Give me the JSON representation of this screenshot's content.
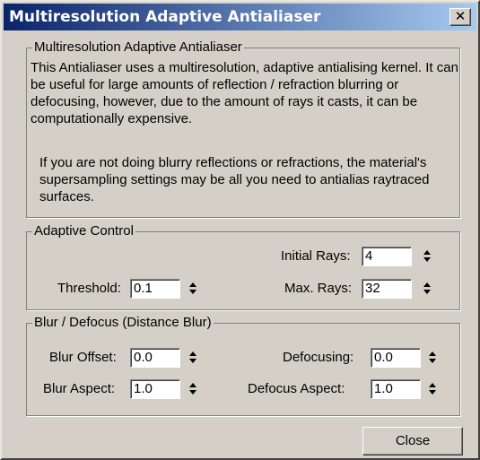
{
  "window": {
    "title": "Multiresolution Adaptive Antialiaser",
    "close_icon": "close-x-icon"
  },
  "description": {
    "legend": "Multiresolution Adaptive Antialiaser",
    "paragraph1": "This Antialiaser uses a multiresolution, adaptive antialising kernel.  It can be useful for large amounts of reflection / refraction blurring or defocusing, however, due to the amount of rays it casts, it can be computationally expensive.",
    "paragraph2": "If you are not doing blurry reflections or refractions, the material's supersampling settings may be all you need to antialias raytraced surfaces."
  },
  "adaptive_control": {
    "legend": "Adaptive Control",
    "initial_rays_label": "Initial Rays:",
    "initial_rays_value": "4",
    "threshold_label": "Threshold:",
    "threshold_value": "0.1",
    "max_rays_label": "Max. Rays:",
    "max_rays_value": "32"
  },
  "blur_defocus": {
    "legend": "Blur / Defocus (Distance Blur)",
    "blur_offset_label": "Blur Offset:",
    "blur_offset_value": "0.0",
    "defocusing_label": "Defocusing:",
    "defocusing_value": "0.0",
    "blur_aspect_label": "Blur Aspect:",
    "blur_aspect_value": "1.0",
    "defocus_aspect_label": "Defocus Aspect:",
    "defocus_aspect_value": "1.0"
  },
  "buttons": {
    "close_label": "Close"
  },
  "colors": {
    "titlebar_start": "#0a246a",
    "titlebar_end": "#a6caf0",
    "face": "#d4d0c8"
  }
}
